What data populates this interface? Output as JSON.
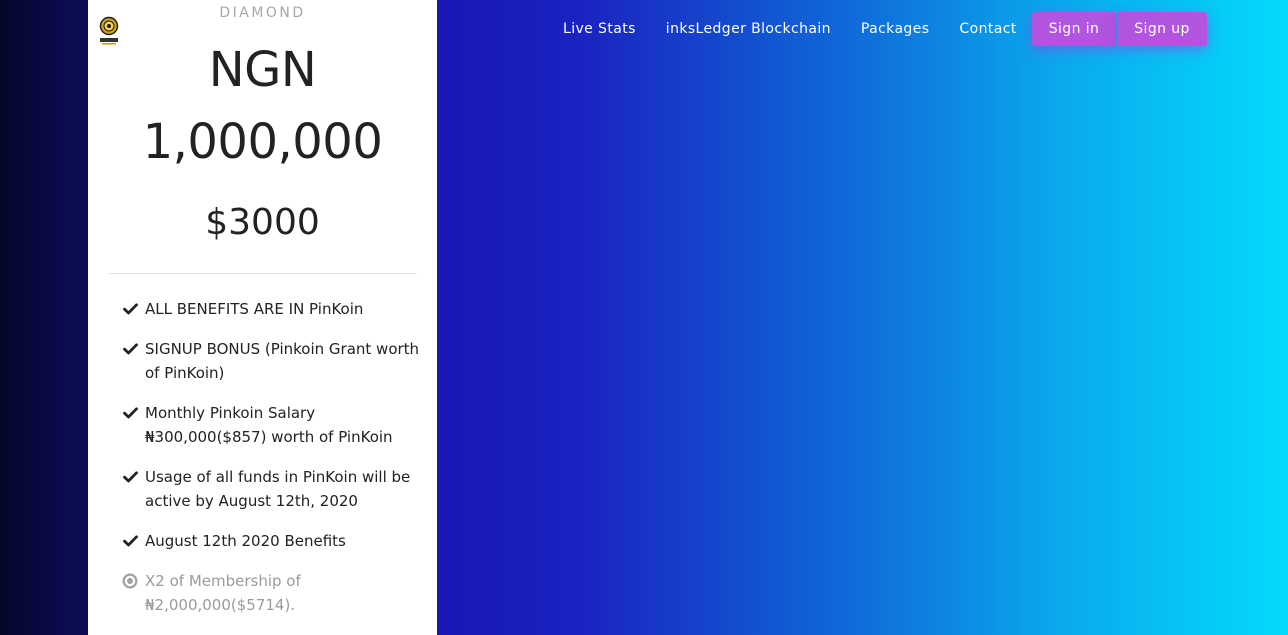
{
  "nav": {
    "links": [
      "Live Stats",
      "inksLedger Blockchain",
      "Packages",
      "Contact"
    ],
    "sign_in": "Sign in",
    "sign_up": "Sign up"
  },
  "card": {
    "logo_icon": "gold-coin-logo-icon",
    "tier": "DIAMOND",
    "price_ngn_line1": "NGN",
    "price_ngn_line2": "1,000,000",
    "price_usd": "$3000",
    "features": [
      {
        "text": "ALL BENEFITS ARE IN PinKoin",
        "icon": "check-icon",
        "active": true
      },
      {
        "text": "SIGNUP BONUS (Pinkoin Grant worth of PinKoin)",
        "icon": "check-icon",
        "active": true
      },
      {
        "text": "Monthly Pinkoin Salary ₦300,000($857) worth of PinKoin",
        "icon": "check-icon",
        "active": true
      },
      {
        "text": "Usage of all funds in PinKoin will be active by August 12th, 2020",
        "icon": "check-icon",
        "active": true
      },
      {
        "text": "August 12th 2020 Benefits",
        "icon": "check-icon",
        "active": true
      },
      {
        "text": "X2 of Membership of ₦2,000,000($5714).",
        "icon": "radio-dot-icon",
        "active": false
      }
    ]
  },
  "colors": {
    "button": "#b154df",
    "gradient_start": "#05062a",
    "gradient_mid": "#1a12b0",
    "gradient_end": "#03dafd",
    "text_dark": "#222222",
    "text_muted": "#9a9a9a"
  }
}
